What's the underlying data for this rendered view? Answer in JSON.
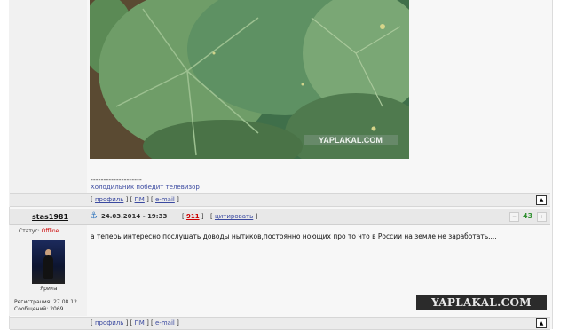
{
  "first_post": {
    "image_watermark": "YAPLAKAL.COM",
    "separator": "--------------------",
    "signature": "Холодильник победит телевизор",
    "footer": {
      "profile": "профиль",
      "pm": "ПМ",
      "email": "e-mail"
    }
  },
  "post": {
    "username": "stas1981",
    "date": "24.03.2014 - 19:33",
    "number": "911",
    "quote": "цитировать",
    "rating": "43",
    "status_label": "Статус:",
    "status_value": "Offline",
    "avatar_caption": "Ярила",
    "registration": "Регистрация: 27.08.12",
    "messages": "Сообщений: 2069",
    "text": "а теперь интересно послушать доводы нытиков,постоянно ноющих про то что в России на земле не заработать....",
    "watermark": "YAPLAKAL.COM",
    "footer": {
      "profile": "профиль",
      "pm": "ПМ",
      "email": "e-mail"
    }
  },
  "colors": {
    "link": "#3b4aa0",
    "number": "#cc0000",
    "rating": "#2f8f2f",
    "status_offline": "#cc0000"
  },
  "icons": {
    "anchor": "anchor-icon",
    "up": "scroll-top-icon",
    "vote_minus": "vote-down-icon",
    "vote_plus": "vote-up-icon"
  }
}
